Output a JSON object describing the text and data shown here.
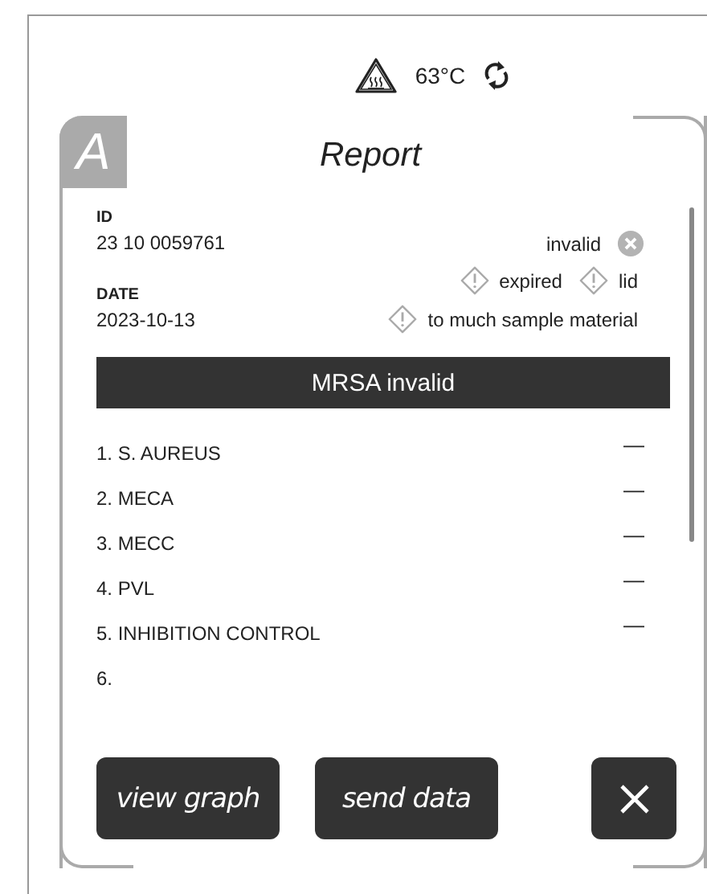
{
  "status": {
    "temperature": "63°C"
  },
  "card": {
    "tab_letter": "A",
    "title": "Report"
  },
  "sample": {
    "id_label": "ID",
    "id_value": "23 10 0059761",
    "date_label": "DATE",
    "date_value": "2023-10-13"
  },
  "flags": [
    [
      {
        "kind": "error",
        "label": "invalid"
      }
    ],
    [
      {
        "kind": "warning",
        "label": "expired"
      },
      {
        "kind": "warning",
        "label": "lid"
      }
    ],
    [
      {
        "kind": "warning",
        "label": "to much sample material"
      }
    ]
  ],
  "banner": "MRSA invalid",
  "results": [
    {
      "name": "1. S. AUREUS",
      "value": "—"
    },
    {
      "name": "2. MECA",
      "value": "—"
    },
    {
      "name": "3. MECC",
      "value": "—"
    },
    {
      "name": "4. PVL",
      "value": "—"
    },
    {
      "name": "5. INHIBITION CONTROL",
      "value": "—"
    },
    {
      "name": "6."
    }
  ],
  "buttons": [
    {
      "kind": "text",
      "label": "view graph"
    },
    {
      "kind": "text",
      "label": "send data"
    },
    {
      "kind": "close"
    }
  ]
}
